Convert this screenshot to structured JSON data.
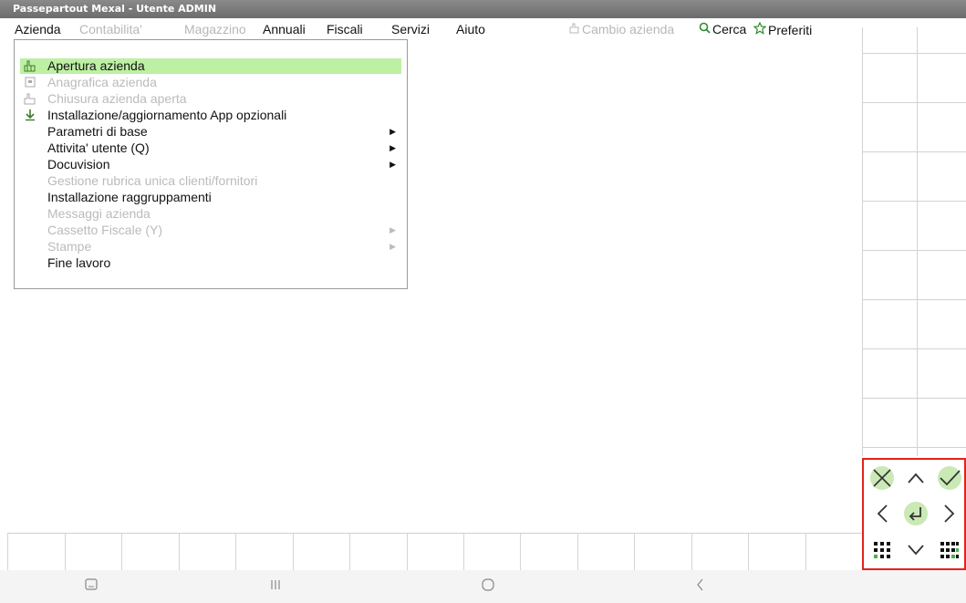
{
  "window": {
    "title": "Passepartout Mexal - Utente ADMIN"
  },
  "menubar": {
    "azienda": "Azienda",
    "contabilita": "Contabilita'",
    "magazzino": "Magazzino",
    "annuali": "Annuali",
    "fiscali": "Fiscali",
    "servizi": "Servizi",
    "aiuto": "Aiuto",
    "cambio_azienda": "Cambio azienda",
    "cerca": "Cerca",
    "preferiti": "Preferiti"
  },
  "dropdown": {
    "items": [
      {
        "label": "Apertura azienda",
        "state": "selected",
        "icon": "hand-icon"
      },
      {
        "label": "Anagrafica azienda",
        "state": "disabled",
        "icon": "card-icon"
      },
      {
        "label": "Chiusura azienda aperta",
        "state": "disabled",
        "icon": "hand-icon"
      },
      {
        "label": "Installazione/aggiornamento App opzionali",
        "state": "enabled",
        "icon": "download-icon"
      },
      {
        "label": "Parametri di base",
        "state": "enabled",
        "submenu": true
      },
      {
        "label": "Attivita' utente (Q)",
        "state": "enabled",
        "submenu": true
      },
      {
        "label": "Docuvision",
        "state": "enabled",
        "submenu": true
      },
      {
        "label": "Gestione rubrica unica clienti/fornitori",
        "state": "disabled"
      },
      {
        "label": "Installazione raggruppamenti",
        "state": "enabled"
      },
      {
        "label": "Messaggi azienda",
        "state": "disabled"
      },
      {
        "label": "Cassetto Fiscale (Y)",
        "state": "disabled",
        "submenu": true
      },
      {
        "label": "Stampe",
        "state": "disabled",
        "submenu": true
      },
      {
        "label": "Fine lavoro",
        "state": "enabled"
      }
    ]
  },
  "colors": {
    "highlight": "#bdf0a3",
    "keypad_border": "#e2231a",
    "keypad_accent": "#c9e9b5"
  }
}
